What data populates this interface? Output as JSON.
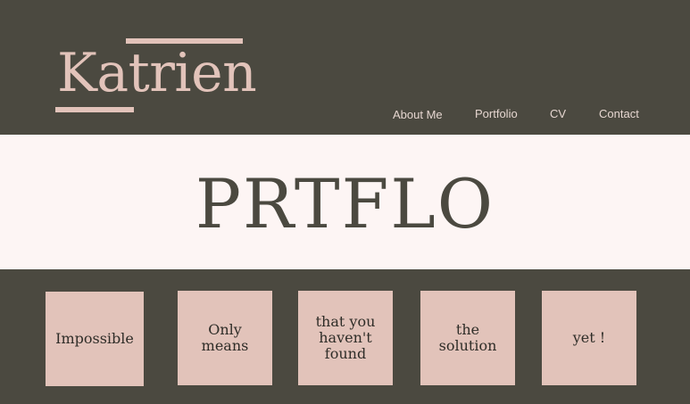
{
  "header": {
    "logo_text": "Katrien",
    "nav": [
      {
        "label": "About Me"
      },
      {
        "label": "Portfolio"
      },
      {
        "label": "CV"
      },
      {
        "label": "Contact"
      }
    ]
  },
  "hero": {
    "title": "PRTFLO"
  },
  "tiles": [
    {
      "text": "Impossible"
    },
    {
      "text": "Only\nmeans"
    },
    {
      "text": "that you\nhaven't\nfound"
    },
    {
      "text": "the\nsolution"
    },
    {
      "text": "yet !"
    }
  ],
  "colors": {
    "background_dark": "#4b4940",
    "accent_pink": "#e2c3ba",
    "hero_background": "#fdf5f4"
  }
}
